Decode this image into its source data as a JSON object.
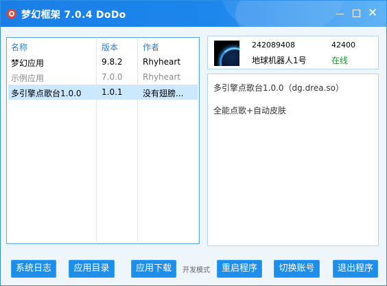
{
  "window": {
    "title": "梦幻框架 7.0.4 DoDo",
    "close_glyph": "✕"
  },
  "plugin_list": {
    "headers": [
      "名称",
      "版本",
      "作者"
    ],
    "rows": [
      {
        "name": "梦幻应用",
        "version": "9.8.2",
        "author": "Rhyheart",
        "state": "normal"
      },
      {
        "name": "示例应用",
        "version": "7.0.0",
        "author": "Rhyheart",
        "state": "disabled"
      },
      {
        "name": "多引擎点歌台1.0.0",
        "version": "1.0.1",
        "author": "没有翅膀...",
        "state": "selected"
      }
    ]
  },
  "account": {
    "id": "242089408",
    "number": "42400",
    "name": "地球机器人1号",
    "status": "在线",
    "status_color": "#1f8f2e"
  },
  "info": {
    "title": "多引擎点歌台1.0.0（dg.drea.so）",
    "description": "全能点歌+自动皮肤"
  },
  "footer": {
    "buttons": {
      "log": "系统日志",
      "catalog": "应用目录",
      "download": "应用下载",
      "restart": "重启程序",
      "switch": "切换账号",
      "exit": "退出程序"
    },
    "dev_mode_label": "开发模式"
  },
  "colors": {
    "accent": "#1e8eeb",
    "header_text": "#2b7fd1",
    "selected_row": "#cce8ff"
  }
}
